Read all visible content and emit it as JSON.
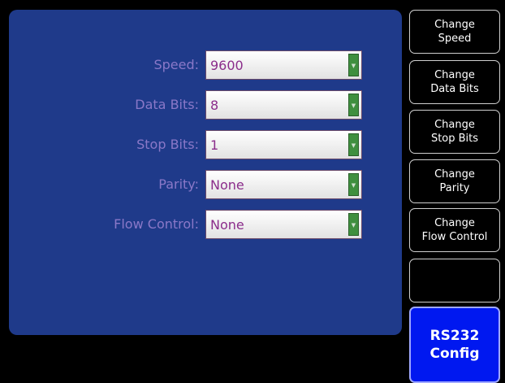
{
  "form": {
    "fields": [
      {
        "label": "Speed:",
        "value": "9600"
      },
      {
        "label": "Data Bits:",
        "value": "8"
      },
      {
        "label": "Stop Bits:",
        "value": "1"
      },
      {
        "label": "Parity:",
        "value": "None"
      },
      {
        "label": "Flow Control:",
        "value": "None"
      }
    ]
  },
  "buttons": [
    {
      "line1": "Change",
      "line2": "Speed"
    },
    {
      "line1": "Change",
      "line2": "Data Bits"
    },
    {
      "line1": "Change",
      "line2": "Stop Bits"
    },
    {
      "line1": "Change",
      "line2": "Parity"
    },
    {
      "line1": "Change",
      "line2": "Flow Control"
    },
    {
      "line1": "",
      "line2": ""
    },
    {
      "line1": "RS232",
      "line2": "Config"
    }
  ],
  "colors": {
    "panel": "#1f3a8a",
    "label": "#8a78c8",
    "value": "#8b2d8b",
    "dropdown_arrow": "#3f8f3f",
    "active_button": "#0018f0"
  }
}
